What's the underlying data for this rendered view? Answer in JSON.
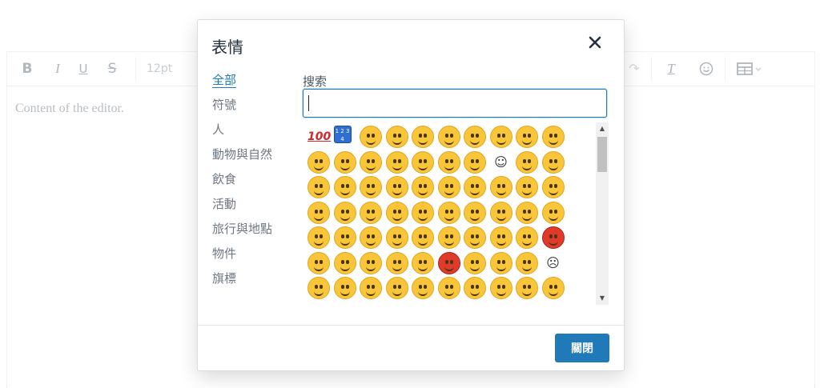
{
  "editor": {
    "font_size": "12pt",
    "content_text": "Content of the editor."
  },
  "dialog": {
    "title": "表情",
    "categories": [
      "全部",
      "符號",
      "人",
      "動物與自然",
      "飲食",
      "活動",
      "旅行與地點",
      "物件",
      "旗標"
    ],
    "active_category": "全部",
    "search_label": "搜索",
    "search_value": "",
    "close_button_label": "關閉"
  },
  "emoji_grid": {
    "rows": [
      [
        "hundred-points",
        "input-numbers",
        "grinning-face",
        "grimacing-face",
        "beaming-face",
        "face-with-tears-of-joy",
        "rolling-on-floor-laughing",
        "smiling-face-with-sweat",
        "grinning-face-big-eyes",
        "grinning-face-smiling-eyes"
      ],
      [
        "grinning-face-with-sweat",
        "grinning-squinting-face",
        "smiling-face-with-halo",
        "winking-face",
        "smiling-face-with-smiling-eyes",
        "slightly-smiling-face",
        "upside-down-face",
        "smiling-face",
        "face-savoring-food",
        "relieved-face"
      ],
      [
        "heart-eyes",
        "smiling-face-with-hearts",
        "face-blowing-kiss",
        "kissing-face",
        "kissing-face-smiling-eyes",
        "kissing-face-closed-eyes",
        "winking-face-with-tongue",
        "zany-face",
        "face-with-monocle",
        "face-with-monocle-alt"
      ],
      [
        "squinting-face-with-tongue",
        "face-with-tongue",
        "money-mouth-face",
        "nerd-face",
        "smiling-face-with-sunglasses",
        "star-struck",
        "clown-face",
        "cowboy-hat-face",
        "hugging-face",
        "smirking-face"
      ],
      [
        "face-without-mouth",
        "neutral-face",
        "expressionless-face",
        "unamused-face",
        "face-with-rolling-eyes",
        "thinking-face",
        "lying-face",
        "smiling-face-with-open-hands",
        "face-with-hand-over-mouth",
        "face-with-symbols-on-mouth"
      ],
      [
        "exploding-head",
        "flushed-face",
        "disappointed-face",
        "worried-face",
        "angry-face",
        "pouting-face",
        "pensive-face",
        "confused-face",
        "slightly-frowning-face",
        "frowning-face"
      ],
      [
        "persevering-face",
        "confounded-face",
        "tired-face",
        "weary-face",
        "face-with-steam",
        "cold-sweat",
        "sad-relieved",
        "cold-face",
        "cold-face-alt",
        "screaming-face"
      ]
    ],
    "colors": {
      "face": "#f8c638",
      "face_border": "#e0a621",
      "red_face": "#e03b2a",
      "accent": "#207ab7"
    }
  }
}
